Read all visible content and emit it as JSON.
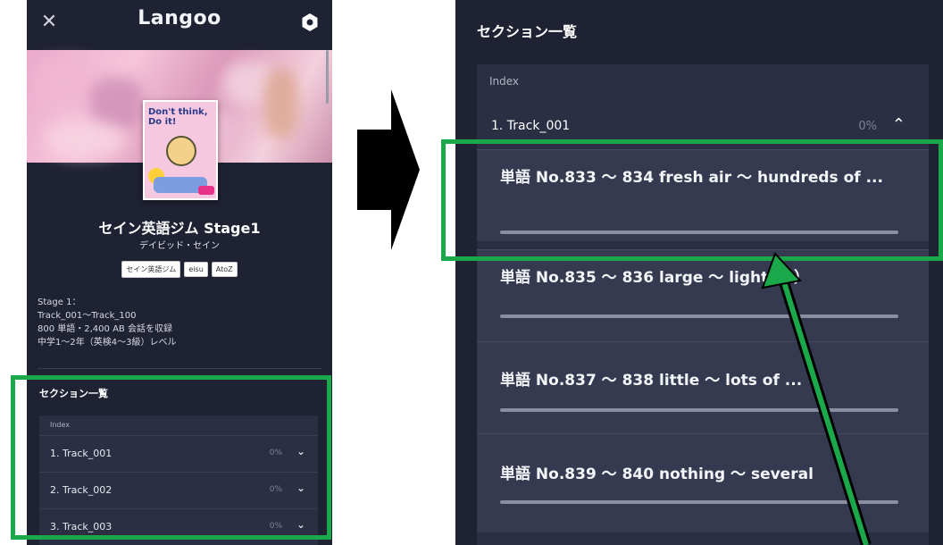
{
  "left_screen": {
    "app_title": "Langoo",
    "course": {
      "cover_text": "Don't think, Do it!",
      "title": "セイン英語ジム Stage1",
      "author": "デイビッド・セイン",
      "tags": [
        "セイン英語ジム",
        "eisu",
        "AtoZ"
      ],
      "description": [
        "Stage 1：",
        "Track_001～Track_100",
        "800 単語・2,400 AB 会話を収録",
        "中学1～2年（英検4～3級）レベル"
      ]
    },
    "sections_title": "セクション一覧",
    "index_label": "Index",
    "tracks": [
      {
        "label": "1. Track_001",
        "progress": "0%"
      },
      {
        "label": "2. Track_002",
        "progress": "0%"
      },
      {
        "label": "3. Track_003",
        "progress": "0%"
      }
    ]
  },
  "right_screen": {
    "sections_title": "セクション一覧",
    "index_label": "Index",
    "expanded_track": {
      "label": "1. Track_001",
      "progress": "0%"
    },
    "subsections": [
      {
        "title": "単語 No.833 ～ 834 fresh air ～ hundreds of ...",
        "progress_fraction": 0
      },
      {
        "title": "単語 No.835 ～ 836 large ～ light（2）",
        "progress_fraction": 0
      },
      {
        "title": "単語 No.837 ～ 838 little ～ lots of ...",
        "progress_fraction": 0
      },
      {
        "title": "単語 No.839 ～ 840 nothing ～ several",
        "progress_fraction": 0
      }
    ]
  },
  "colors": {
    "background": "#1f2233",
    "panel": "#2b2f43",
    "highlight_box": "#1aa84b",
    "arrow": "#000000"
  },
  "icons": [
    "close-icon",
    "gear-icon",
    "chevron-down-icon",
    "chevron-up-icon",
    "arrow-right-icon",
    "pointer-arrow-icon"
  ]
}
